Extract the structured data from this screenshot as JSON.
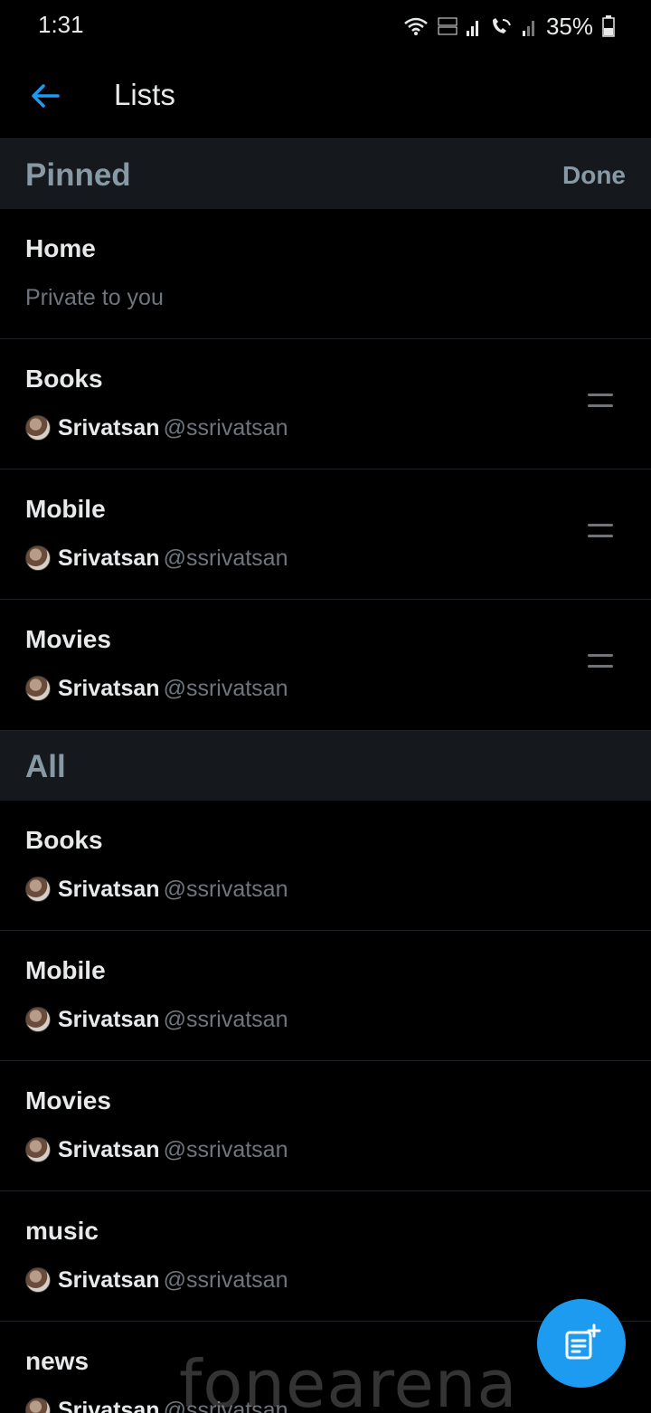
{
  "status_bar": {
    "time": "1:31",
    "battery": "35%",
    "icons": [
      "wifi-icon",
      "volte-icon",
      "signal-icon",
      "wifi-calling-icon",
      "signal-icon",
      "battery-icon"
    ]
  },
  "app_bar": {
    "title": "Lists",
    "back_icon": "arrow-left-icon"
  },
  "pinned_section": {
    "title": "Pinned",
    "done_label": "Done",
    "items": [
      {
        "name": "Home",
        "subtitle": "Private to you"
      },
      {
        "name": "Books",
        "owner_name": "Srivatsan",
        "owner_handle": "@ssrivatsan"
      },
      {
        "name": "Mobile",
        "owner_name": "Srivatsan",
        "owner_handle": "@ssrivatsan"
      },
      {
        "name": "Movies",
        "owner_name": "Srivatsan",
        "owner_handle": "@ssrivatsan"
      }
    ]
  },
  "all_section": {
    "title": "All",
    "items": [
      {
        "name": "Books",
        "owner_name": "Srivatsan",
        "owner_handle": "@ssrivatsan"
      },
      {
        "name": "Mobile",
        "owner_name": "Srivatsan",
        "owner_handle": "@ssrivatsan"
      },
      {
        "name": "Movies",
        "owner_name": "Srivatsan",
        "owner_handle": "@ssrivatsan"
      },
      {
        "name": "music",
        "owner_name": "Srivatsan",
        "owner_handle": "@ssrivatsan"
      },
      {
        "name": "news",
        "owner_name": "Srivatsan",
        "owner_handle": "@ssrivatsan"
      }
    ]
  },
  "fab": {
    "icon": "new-list-icon"
  },
  "watermark": "fonearena",
  "colors": {
    "background": "#000000",
    "section_bg": "#15181c",
    "accent": "#1d9bf0",
    "muted_text": "#6e767d",
    "header_text": "#8899a6"
  }
}
